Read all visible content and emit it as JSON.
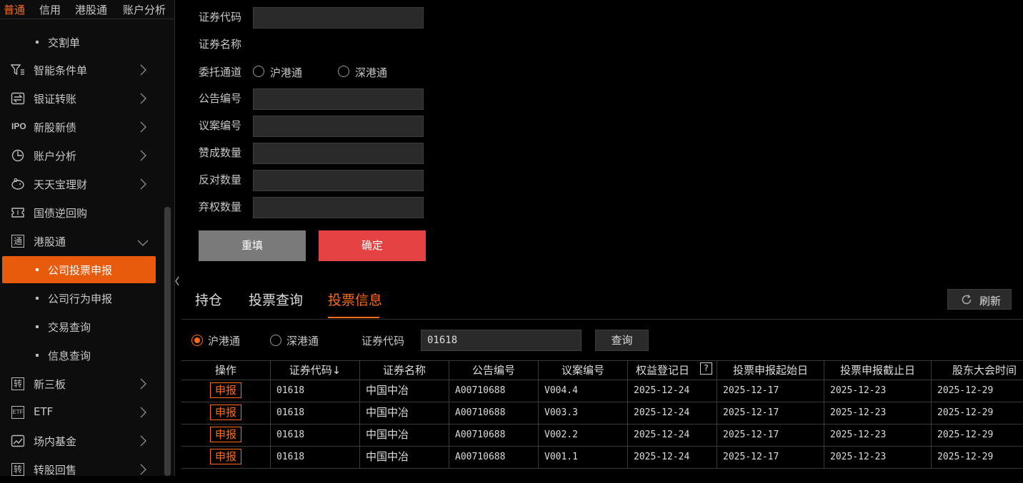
{
  "sidebar": {
    "top_tabs": [
      "普通",
      "信用",
      "港股通",
      "账户分析"
    ],
    "items": [
      {
        "label": "交割单",
        "kind": "sub"
      },
      {
        "label": "智能条件单",
        "kind": "nav",
        "icon": "filter-icon"
      },
      {
        "label": "银证转账",
        "kind": "nav",
        "icon": "transfer-icon"
      },
      {
        "label": "新股新债",
        "kind": "nav",
        "icon": "ipo-icon"
      },
      {
        "label": "账户分析",
        "kind": "nav",
        "icon": "chart-clock-icon"
      },
      {
        "label": "天天宝理财",
        "kind": "nav",
        "icon": "piggy-bank-icon"
      },
      {
        "label": "国债逆回购",
        "kind": "nav",
        "icon": "ticket-icon"
      },
      {
        "label": "港股通",
        "kind": "nav-open",
        "icon": "hk-connect-icon"
      },
      {
        "label": "公司投票申报",
        "kind": "sub-active"
      },
      {
        "label": "公司行为申报",
        "kind": "sub"
      },
      {
        "label": "交易查询",
        "kind": "sub"
      },
      {
        "label": "信息查询",
        "kind": "sub"
      },
      {
        "label": "新三板",
        "kind": "nav",
        "icon": "zhuan-icon"
      },
      {
        "label": "ETF",
        "kind": "nav",
        "icon": "etf-icon"
      },
      {
        "label": "场内基金",
        "kind": "nav",
        "icon": "trend-chart-icon"
      },
      {
        "label": "转股回售",
        "kind": "nav",
        "icon": "zhuan-icon"
      }
    ],
    "icon_text": {
      "ipo": "IPO",
      "zhuan": "转",
      "etf": "ETF",
      "tong": "通"
    }
  },
  "form": {
    "security_code_label": "证券代码",
    "security_code_value": "",
    "security_name_label": "证券名称",
    "channel_label": "委托通道",
    "channel_options": [
      "沪港通",
      "深港通"
    ],
    "announcement_label": "公告编号",
    "proposal_label": "议案编号",
    "for_qty_label": "赞成数量",
    "against_qty_label": "反对数量",
    "abstain_qty_label": "弃权数量",
    "reset_label": "重填",
    "confirm_label": "确定"
  },
  "tabs": {
    "items": [
      "持仓",
      "投票查询",
      "投票信息"
    ],
    "active": "投票信息",
    "refresh_label": "刷新"
  },
  "filter": {
    "channel_options": [
      "沪港通",
      "深港通"
    ],
    "selected_channel": "沪港通",
    "code_label": "证券代码",
    "code_value": "01618",
    "query_label": "查询"
  },
  "table": {
    "columns": [
      "操作",
      "证券代码↓",
      "证券名称",
      "公告编号",
      "议案编号",
      "权益登记日",
      "投票申报起始日",
      "投票申报截止日",
      "股东大会时间"
    ],
    "help_glyph": "?",
    "rows": [
      {
        "action": "申报",
        "code": "01618",
        "name": "中国中冶",
        "announcement": "A00710688",
        "proposal": "V004.4",
        "record_date": "2025-12-24",
        "start_date": "2025-12-17",
        "end_date": "2025-12-23",
        "meeting_time": "2025-12-29"
      },
      {
        "action": "申报",
        "code": "01618",
        "name": "中国中冶",
        "announcement": "A00710688",
        "proposal": "V003.3",
        "record_date": "2025-12-24",
        "start_date": "2025-12-17",
        "end_date": "2025-12-23",
        "meeting_time": "2025-12-29"
      },
      {
        "action": "申报",
        "code": "01618",
        "name": "中国中冶",
        "announcement": "A00710688",
        "proposal": "V002.2",
        "record_date": "2025-12-24",
        "start_date": "2025-12-17",
        "end_date": "2025-12-23",
        "meeting_time": "2025-12-29"
      },
      {
        "action": "申报",
        "code": "01618",
        "name": "中国中冶",
        "announcement": "A00710688",
        "proposal": "V001.1",
        "record_date": "2025-12-24",
        "start_date": "2025-12-17",
        "end_date": "2025-12-23",
        "meeting_time": "2025-12-29"
      }
    ]
  },
  "colors": {
    "accent": "#ff6a1a",
    "active_bg": "#e85a0c",
    "confirm": "#e54343",
    "reset": "#7a7a7a",
    "background": "#000000"
  }
}
